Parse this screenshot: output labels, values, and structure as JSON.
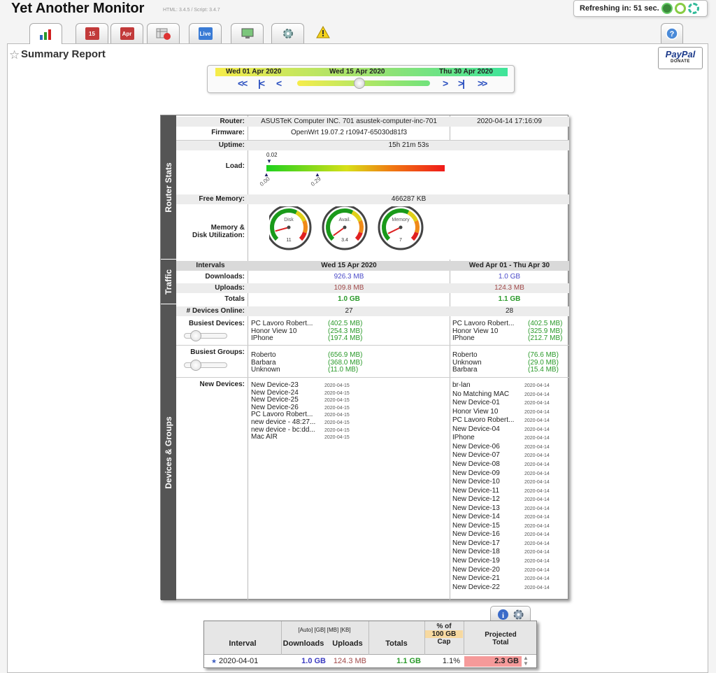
{
  "app": {
    "title": "Yet Another Monitor",
    "version": "HTML: 3.4.5 / Script: 3.4.7"
  },
  "refresh": {
    "label": "Refreshing in: 51 sec."
  },
  "tabs": [
    {
      "name": "summary",
      "icon": "bar-chart-icon"
    },
    {
      "name": "daily",
      "icon": "calendar-15-icon",
      "text": "15"
    },
    {
      "name": "monthly",
      "icon": "calendar-apr-icon",
      "text": "Apr"
    },
    {
      "name": "history",
      "icon": "table-clock-icon"
    },
    {
      "name": "live",
      "icon": "wifi-live-icon",
      "text": "Live"
    },
    {
      "name": "devices",
      "icon": "monitor-icon"
    },
    {
      "name": "settings",
      "icon": "gear-icon"
    },
    {
      "name": "alerts",
      "icon": "warning-icon"
    }
  ],
  "report": {
    "title": "Summary Report"
  },
  "paypal": {
    "brand": "PayPal",
    "action": "DONATE"
  },
  "date_nav": {
    "start": "Wed 01 Apr 2020",
    "current": "Wed 15 Apr 2020",
    "end": "Thu 30 Apr 2020",
    "position": 0.47
  },
  "sections": {
    "router": "Router Stats",
    "traffic": "Traffic",
    "devices": "Devices & Groups"
  },
  "router": {
    "router_label": "Router:",
    "router": "ASUSTeK Computer INC. 701 asustek-computer-inc-701",
    "timestamp": "2020-04-14 17:16:09",
    "firmware_label": "Firmware:",
    "firmware": "OpenWrt 19.07.2 r10947-65030d81f3",
    "uptime_label": "Uptime:",
    "uptime": "15h 21m 53s",
    "load_label": "Load:",
    "load_top": "0.02",
    "load_a": "0.00",
    "load_b": "0.29",
    "mem_label": "Free Memory:",
    "mem": "466287 KB",
    "util_label_1": "Memory &",
    "util_label_2": "Disk Utilization:",
    "gauges": [
      {
        "name": "Disk",
        "value": "11",
        "pct": 11
      },
      {
        "name": "Avail.",
        "value": "3.4",
        "pct": 3.4
      },
      {
        "name": "Memory",
        "value": "7",
        "pct": 7
      }
    ]
  },
  "traffic": {
    "intervals_label": "Intervals",
    "col1": "Wed 15 Apr 2020",
    "col2": "Wed Apr 01 - Thu Apr 30",
    "down_label": "Downloads:",
    "down1": "926.3 MB",
    "down2": "1.0 GB",
    "up_label": "Uploads:",
    "up1": "109.8 MB",
    "up2": "124.3 MB",
    "tot_label": "Totals",
    "tot1": "1.0 GB",
    "tot2": "1.1 GB"
  },
  "devices": {
    "online_label": "# Devices Online:",
    "online1": "27",
    "online2": "28",
    "busiest_label": "Busiest Devices:",
    "busiest1": [
      {
        "n": "PC Lavoro Robert...",
        "v": "(402.5 MB)"
      },
      {
        "n": "Honor View 10",
        "v": "(254.3 MB)"
      },
      {
        "n": "IPhone",
        "v": "(197.4 MB)"
      }
    ],
    "busiest2": [
      {
        "n": "PC Lavoro Robert...",
        "v": "(402.5 MB)"
      },
      {
        "n": "Honor View 10",
        "v": "(325.9 MB)"
      },
      {
        "n": "IPhone",
        "v": "(212.7 MB)"
      }
    ],
    "groups_label": "Busiest Groups:",
    "groups1": [
      {
        "n": "Roberto",
        "v": "(656.9 MB)"
      },
      {
        "n": "Barbara",
        "v": "(368.0 MB)"
      },
      {
        "n": "Unknown",
        "v": "(11.0 MB)"
      }
    ],
    "groups2": [
      {
        "n": "Roberto",
        "v": "(76.6 MB)"
      },
      {
        "n": "Unknown",
        "v": "(29.0 MB)"
      },
      {
        "n": "Barbara",
        "v": "(15.4 MB)"
      }
    ],
    "new_label": "New Devices:",
    "new1": [
      {
        "n": "New Device-23",
        "d": "2020-04-15"
      },
      {
        "n": "New Device-24",
        "d": "2020-04-15"
      },
      {
        "n": "New Device-25",
        "d": "2020-04-15"
      },
      {
        "n": "New Device-26",
        "d": "2020-04-15"
      },
      {
        "n": "PC Lavoro Robert...",
        "d": "2020-04-15"
      },
      {
        "n": "new device - 48:27...",
        "d": "2020-04-15"
      },
      {
        "n": "new device - bc:dd...",
        "d": "2020-04-15"
      },
      {
        "n": "Mac AIR",
        "d": "2020-04-15"
      }
    ],
    "new2": [
      {
        "n": "br-lan",
        "d": "2020-04-14"
      },
      {
        "n": "No Matching MAC",
        "d": "2020-04-14"
      },
      {
        "n": "New Device-01",
        "d": "2020-04-14"
      },
      {
        "n": "Honor View 10",
        "d": "2020-04-14"
      },
      {
        "n": "PC Lavoro Robert...",
        "d": "2020-04-14"
      },
      {
        "n": "New Device-04",
        "d": "2020-04-14"
      },
      {
        "n": "IPhone",
        "d": "2020-04-14"
      },
      {
        "n": "New Device-06",
        "d": "2020-04-14"
      },
      {
        "n": "New Device-07",
        "d": "2020-04-14"
      },
      {
        "n": "New Device-08",
        "d": "2020-04-14"
      },
      {
        "n": "New Device-09",
        "d": "2020-04-14"
      },
      {
        "n": "New Device-10",
        "d": "2020-04-14"
      },
      {
        "n": "New Device-11",
        "d": "2020-04-14"
      },
      {
        "n": "New Device-12",
        "d": "2020-04-14"
      },
      {
        "n": "New Device-13",
        "d": "2020-04-14"
      },
      {
        "n": "New Device-14",
        "d": "2020-04-14"
      },
      {
        "n": "New Device-15",
        "d": "2020-04-14"
      },
      {
        "n": "New Device-16",
        "d": "2020-04-14"
      },
      {
        "n": "New Device-17",
        "d": "2020-04-14"
      },
      {
        "n": "New Device-18",
        "d": "2020-04-14"
      },
      {
        "n": "New Device-19",
        "d": "2020-04-14"
      },
      {
        "n": "New Device-20",
        "d": "2020-04-14"
      },
      {
        "n": "New Device-21",
        "d": "2020-04-14"
      },
      {
        "n": "New Device-22",
        "d": "2020-04-14"
      }
    ]
  },
  "interval_table": {
    "units": "[Auto] [GB] [MB] [KB]",
    "h_interval": "Interval",
    "h_down": "Downloads",
    "h_up": "Uploads",
    "h_totals": "Totals",
    "h_pct_1": "% of",
    "h_pct_2": "100 GB",
    "h_pct_3": "Cap",
    "h_proj_1": "Projected",
    "h_proj_2": "Total",
    "row": {
      "interval": "2020-04-01",
      "down": "1.0 GB",
      "up": "124.3 MB",
      "total": "1.1 GB",
      "pct": "1.1%",
      "proj": "2.3 GB"
    }
  }
}
